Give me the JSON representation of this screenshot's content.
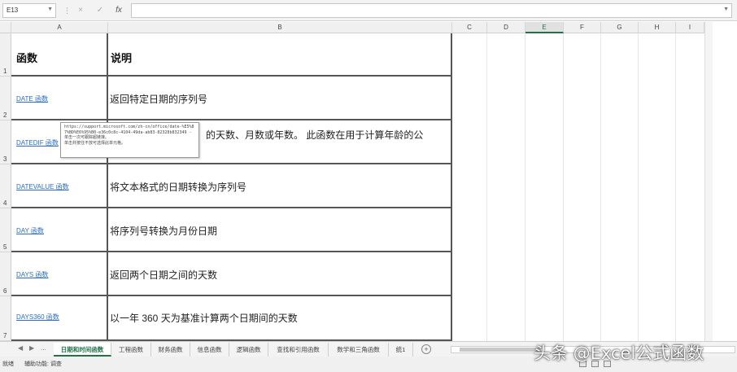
{
  "formula_bar": {
    "name_box": "E13",
    "cancel_icon": "×",
    "enter_icon": "✓",
    "function_icon": "fx",
    "formula": ""
  },
  "columns": [
    "A",
    "B",
    "C",
    "D",
    "E",
    "F",
    "G",
    "H",
    "I"
  ],
  "active_column": "E",
  "table": {
    "header": {
      "row": "1",
      "col_a": "函数",
      "col_b": "说明"
    },
    "rows": [
      {
        "row": "2",
        "func": "DATE 函数",
        "desc": "返回特定日期的序列号"
      },
      {
        "row": "3",
        "func": "DATEDIF 函数",
        "desc": "的天数、月数或年数。 此函数在用于计算年龄的公"
      },
      {
        "row": "4",
        "func": "DATEVALUE 函数",
        "desc": "将文本格式的日期转换为序列号"
      },
      {
        "row": "5",
        "func": "DAY 函数",
        "desc": "将序列号转换为月份日期"
      },
      {
        "row": "6",
        "func": "DAYS 函数",
        "desc": "返回两个日期之间的天数"
      },
      {
        "row": "7",
        "func": "DAYS360 函数",
        "desc": "以一年 360 天为基准计算两个日期间的天数"
      }
    ]
  },
  "tooltip": {
    "url": "https://support.microsoft.com/zh-cn/office/date-%E5%87%BD%E6%95%B0-e36c0c8c-4104-49da-ab83-82328b832349 -",
    "line_click": "单击一次可跟踪超链接。",
    "line_hold": "单击并按住不放可选择此单元格。"
  },
  "sheet_tabs": {
    "nav": [
      "◀",
      "▶",
      "..."
    ],
    "tabs": [
      "日期和时间函数",
      "工程函数",
      "财务函数",
      "信息函数",
      "逻辑函数",
      "查找和引用函数",
      "数学和三角函数",
      "统1"
    ],
    "active": "日期和时间函数",
    "add_icon": "+"
  },
  "status_bar": {
    "ready": "就绪",
    "accessibility": "辅助功能: 调查"
  },
  "watermark": "头条 @Excel公式函数"
}
